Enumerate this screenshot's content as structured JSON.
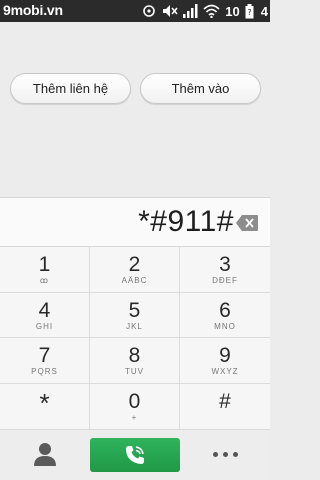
{
  "status_bar": {
    "brand": "9mobi.vn",
    "battery_text": "10",
    "time_partial": "4"
  },
  "top_buttons": {
    "add_contact": "Thêm liên hệ",
    "add_to": "Thêm vào"
  },
  "dialer": {
    "number": "*#911#"
  },
  "keypad": [
    {
      "digit": "1",
      "letters": "ꝏ"
    },
    {
      "digit": "2",
      "letters": "AÄBC"
    },
    {
      "digit": "3",
      "letters": "DĐEF"
    },
    {
      "digit": "4",
      "letters": "GHI"
    },
    {
      "digit": "5",
      "letters": "JKL"
    },
    {
      "digit": "6",
      "letters": "MNO"
    },
    {
      "digit": "7",
      "letters": "PQRS"
    },
    {
      "digit": "8",
      "letters": "TUV"
    },
    {
      "digit": "9",
      "letters": "WXYZ"
    },
    {
      "digit": "*",
      "letters": ""
    },
    {
      "digit": "0",
      "letters": "+"
    },
    {
      "digit": "#",
      "letters": ""
    }
  ],
  "icons": {
    "contacts": "person-icon",
    "call": "phone-icon",
    "more": "more-dots-icon"
  },
  "colors": {
    "call_button": "#26a651",
    "status_bar": "#2b2b2b"
  }
}
